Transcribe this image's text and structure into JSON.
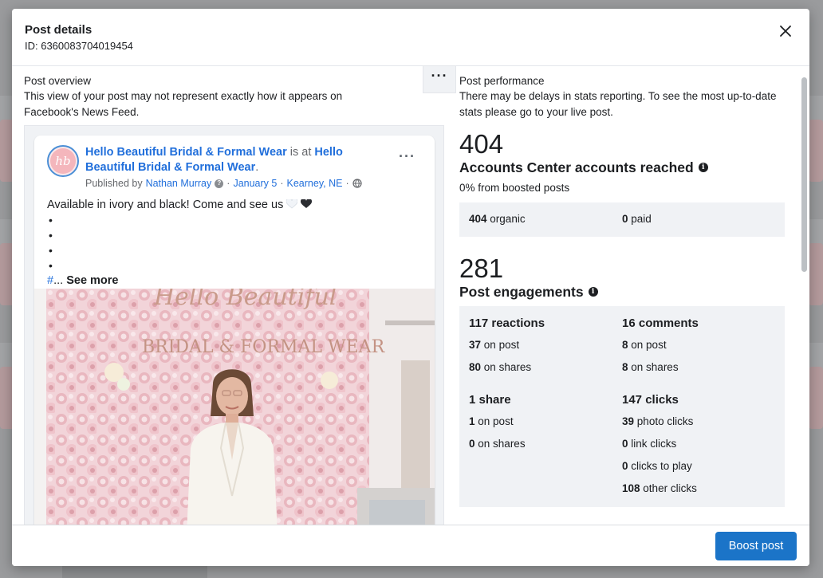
{
  "modal": {
    "title": "Post details",
    "id_line": "ID: 6360083704019454",
    "footer_button": "Boost post"
  },
  "overview": {
    "title": "Post overview",
    "description": "This view of your post may not represent exactly how it appears on Facebook's News Feed.",
    "more_label": "···"
  },
  "post": {
    "avatar_initials": "hb",
    "page_name": "Hello Beautiful Bridal & Formal Wear",
    "is_at": " is at ",
    "location_name": "Hello Beautiful Bridal & Formal Wear",
    "period": ".",
    "published_by": "Published by",
    "author": "Nathan Murray",
    "date": "January 5",
    "place": "Kearney, NE",
    "separator": "·",
    "text": "Available in ivory and black! Come and see us",
    "bullets": [
      "•",
      "•",
      "•",
      "•"
    ],
    "hash": "#",
    "ellipsis": "...",
    "see_more": "See more",
    "image_sign_line1": "Hello Beautiful",
    "image_sign_line2": "BRIDAL & FORMAL WEAR"
  },
  "performance": {
    "title": "Post performance",
    "description": "There may be delays in stats reporting. To see the most up-to-date stats please go to your live post.",
    "reach": {
      "value": "404",
      "label": "Accounts Center accounts reached",
      "boosted_note": "0% from boosted posts",
      "organic_value": "404",
      "organic_label": "organic",
      "paid_value": "0",
      "paid_label": "paid"
    },
    "engagements": {
      "value": "281",
      "label": "Post engagements",
      "reactions": {
        "title": "117 reactions",
        "on_post_value": "37",
        "on_post_label": "on post",
        "on_shares_value": "80",
        "on_shares_label": "on shares"
      },
      "comments": {
        "title": "16 comments",
        "on_post_value": "8",
        "on_post_label": "on post",
        "on_shares_value": "8",
        "on_shares_label": "on shares"
      },
      "shares": {
        "title": "1 share",
        "on_post_value": "1",
        "on_post_label": "on post",
        "on_shares_value": "0",
        "on_shares_label": "on shares"
      },
      "clicks": {
        "title": "147 clicks",
        "photo_value": "39",
        "photo_label": "photo clicks",
        "link_value": "0",
        "link_label": "link clicks",
        "play_value": "0",
        "play_label": "clicks to play",
        "other_value": "108",
        "other_label": "other clicks"
      }
    }
  },
  "colors": {
    "link": "#216fdb",
    "button": "#1b74c8",
    "stat_bg": "#f0f2f5"
  }
}
